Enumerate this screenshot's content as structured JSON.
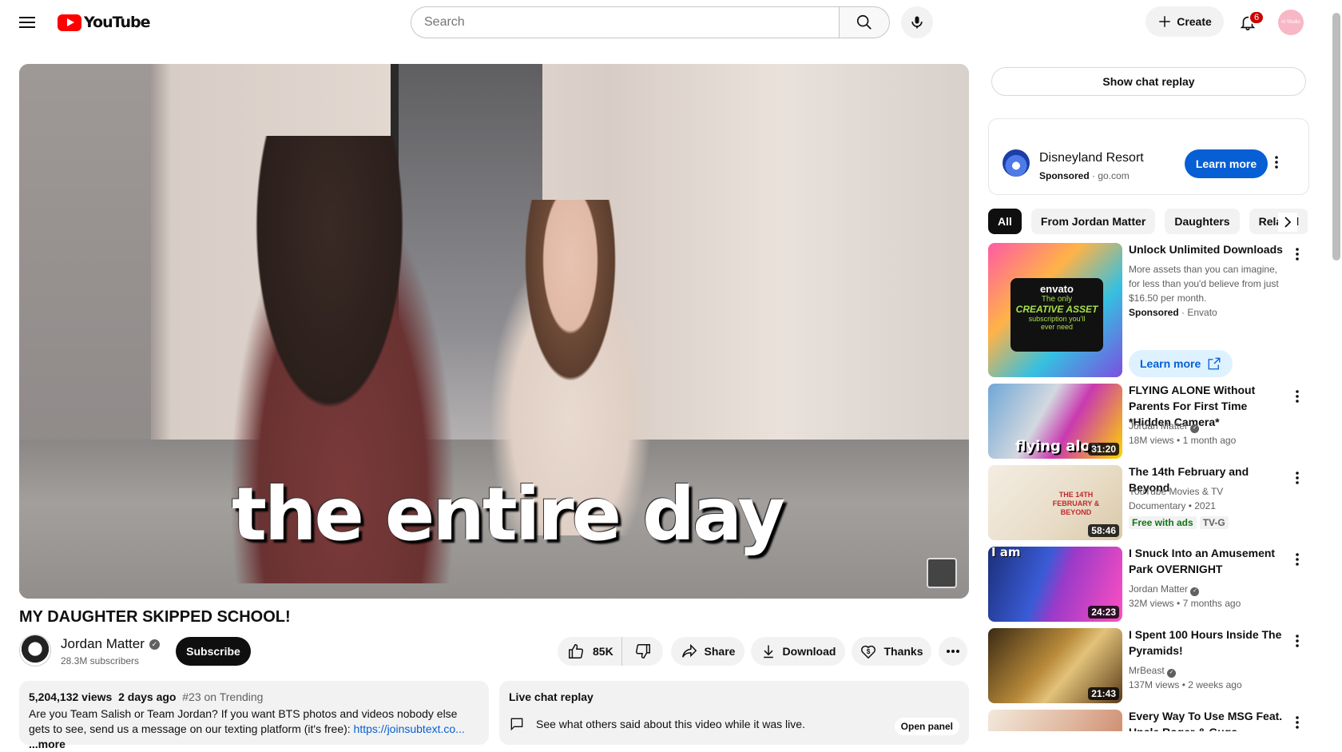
{
  "header": {
    "logo_text": "YouTube",
    "search_placeholder": "Search",
    "create_label": "Create",
    "notifications_count": "6",
    "avatar_text": "nt Studio"
  },
  "video": {
    "caption": "the entire day",
    "title": "MY DAUGHTER SKIPPED SCHOOL!"
  },
  "channel": {
    "name": "Jordan Matter",
    "subscribers": "28.3M subscribers",
    "subscribe_label": "Subscribe"
  },
  "actions": {
    "likes": "85K",
    "share": "Share",
    "download": "Download",
    "thanks": "Thanks"
  },
  "description": {
    "views": "5,204,132 views",
    "age": "2 days ago",
    "trending": "#23 on Trending",
    "text": "Are you Team Salish or Team Jordan? If you want BTS photos and videos nobody else gets to see, send us a message on our texting platform (it's free): ",
    "link": "https://joinsubtext.co...",
    "more": "...more"
  },
  "live_chat": {
    "title": "Live chat replay",
    "text": "See what others said about this video while it was live.",
    "open_panel": "Open panel"
  },
  "sidebar": {
    "show_chat_replay": "Show chat replay",
    "ad": {
      "name": "Disneyland Resort",
      "sponsored": "Sponsored",
      "domain": "go.com",
      "learn_more": "Learn more"
    },
    "chips": [
      "All",
      "From Jordan Matter",
      "Daughters",
      "Related"
    ],
    "sponsored_video": {
      "thumb_brand": "envato",
      "thumb_line1": "The only",
      "thumb_line2": "CREATIVE ASSET",
      "thumb_line3": "subscription you'll",
      "thumb_line4": "ever need",
      "title": "Unlock Unlimited Downloads",
      "text": "More assets than you can imagine, for less than you'd believe from just $16.50 per month.",
      "sponsored": "Sponsored",
      "advertiser": "Envato",
      "learn_more": "Learn more"
    },
    "videos": [
      {
        "title": "FLYING ALONE Without Parents For First Time *Hidden Camera*",
        "channel": "Jordan Matter",
        "views": "18M views",
        "age": "1 month ago",
        "duration": "31:20",
        "thumb_text": "flying alon"
      },
      {
        "title": "The 14th February and Beyond",
        "channel": "YouTube Movies & TV",
        "meta": "Documentary • 2021",
        "badge1": "Free with ads",
        "badge2": "TV-G",
        "duration": "58:46",
        "thumb_text": "THE 14TH FEBRUARY & BEYOND"
      },
      {
        "title": "I Snuck Into an Amusement Park OVERNIGHT",
        "channel": "Jordan Matter",
        "views": "32M views",
        "age": "7 months ago",
        "duration": "24:23",
        "thumb_text": "I am"
      },
      {
        "title": "I Spent 100 Hours Inside The Pyramids!",
        "channel": "MrBeast",
        "views": "137M views",
        "age": "2 weeks ago",
        "duration": "21:43"
      },
      {
        "title": "Every Way To Use MSG Feat. Uncle Roger & Guga"
      }
    ]
  },
  "colors": {
    "accent_blue": "#065fd4",
    "brand_red": "#ff0000",
    "chip_bg": "#f2f2f2",
    "text_primary": "#0f0f0f",
    "text_secondary": "#606060"
  }
}
